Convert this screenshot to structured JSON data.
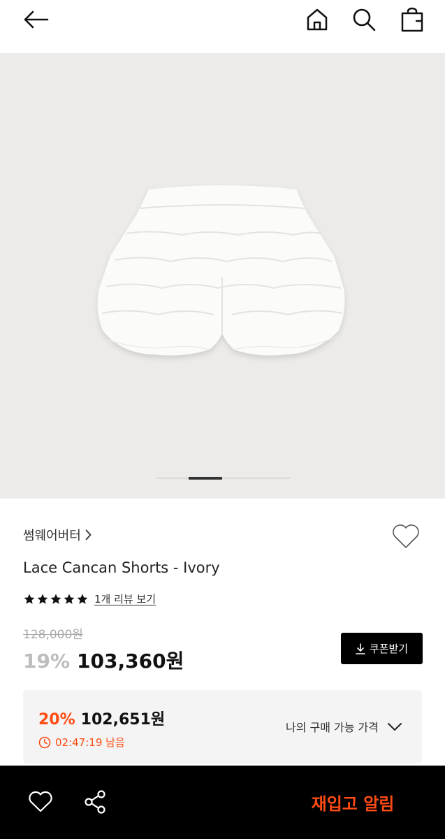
{
  "header": {
    "icons": [
      "back-arrow-icon",
      "home-icon",
      "search-icon",
      "shopping-bag-icon"
    ]
  },
  "gallery": {
    "image": "lace-cancan-shorts-ivory",
    "current_index": 2,
    "total": 4
  },
  "product": {
    "brand": "썸웨어버터",
    "title": "Lace Cancan Shorts - Ivory",
    "rating_stars": 5,
    "review_link": "1개 리뷰 보기",
    "original_price": "128,000원",
    "discount": "19%",
    "price": "103,360원",
    "coupon_button": "쿠폰받기"
  },
  "member_price": {
    "discount": "20%",
    "price": "102,651원",
    "countdown": "02:47:19 남음",
    "label": "나의 구매 가능 가격"
  },
  "bottom_bar": {
    "restock_button": "재입고 알림",
    "icons": [
      "heart-icon",
      "share-icon"
    ]
  },
  "colors": {
    "accent": "#ff4b14",
    "bottom_bar": "#000000",
    "image_background": "#ecebea"
  }
}
